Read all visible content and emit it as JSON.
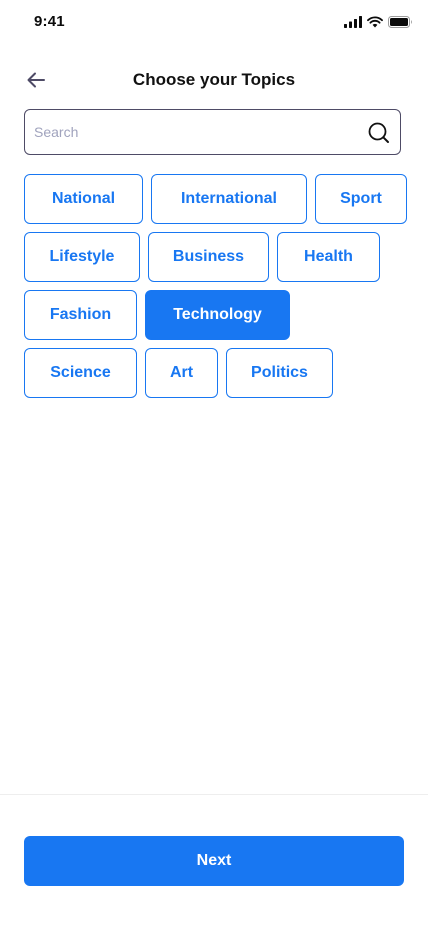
{
  "status_bar": {
    "time": "9:41",
    "icons": [
      "cellular-signal-icon",
      "wifi-icon",
      "battery-icon"
    ]
  },
  "header": {
    "back_icon": "arrow-left-icon",
    "title": "Choose your Topics"
  },
  "search": {
    "value": "",
    "placeholder": "Search",
    "icon": "search-icon"
  },
  "topics": {
    "rows": [
      [
        {
          "label": "National",
          "selected": false
        },
        {
          "label": "International",
          "selected": false
        },
        {
          "label": "Sport",
          "selected": false
        }
      ],
      [
        {
          "label": "Lifestyle",
          "selected": false
        },
        {
          "label": "Business",
          "selected": false
        },
        {
          "label": "Health",
          "selected": false
        }
      ],
      [
        {
          "label": "Fashion",
          "selected": false
        },
        {
          "label": "Technology",
          "selected": true
        }
      ],
      [
        {
          "label": "Science",
          "selected": false
        },
        {
          "label": "Art",
          "selected": false
        },
        {
          "label": "Politics",
          "selected": false
        }
      ]
    ]
  },
  "footer": {
    "next_label": "Next"
  },
  "colors": {
    "accent": "#1877F2",
    "text": "#0B0B0B",
    "border": "#4E4B66",
    "placeholder": "#A0A3BD"
  }
}
